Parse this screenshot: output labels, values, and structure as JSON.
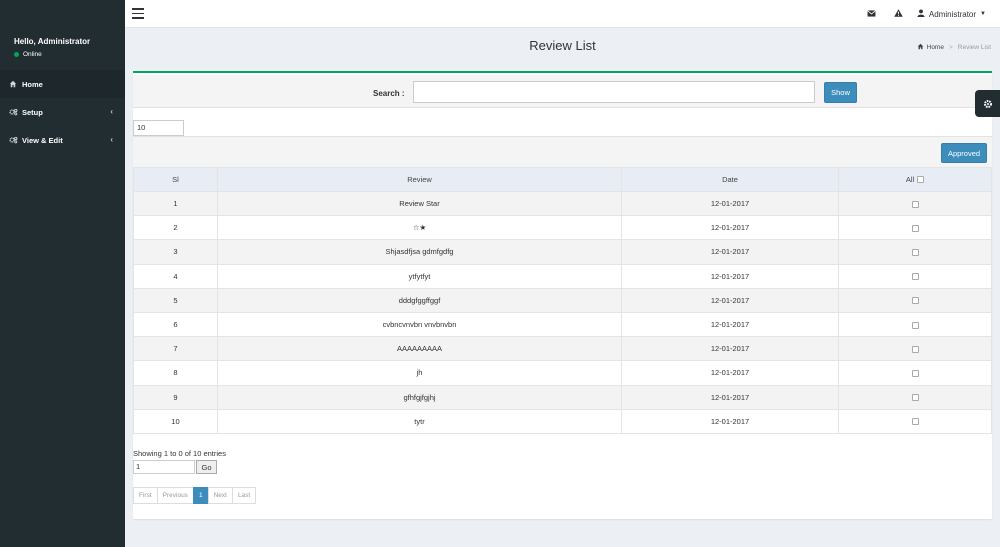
{
  "sidebar": {
    "greeting": "Hello, Administrator",
    "status": "Online",
    "items": [
      {
        "label": "Home",
        "icon": "home-icon"
      },
      {
        "label": "Setup",
        "icon": "cogs-icon"
      },
      {
        "label": "View & Edit",
        "icon": "cogs-icon"
      }
    ]
  },
  "navbar": {
    "user": "Administrator",
    "icons": [
      "envelope-icon",
      "warning-icon",
      "user-icon"
    ]
  },
  "header": {
    "title": "Review List",
    "breadcrumb": {
      "home": "Home",
      "current": "Review List"
    }
  },
  "search": {
    "label": "Search :",
    "value": "",
    "button": "Show"
  },
  "page_size": "10",
  "actions": {
    "approved": "Approved"
  },
  "table": {
    "columns": {
      "sl": "Sl",
      "review": "Review",
      "date": "Date",
      "all": "All"
    },
    "rows": [
      {
        "sl": "1",
        "review": "Review Star",
        "date": "12-01-2017"
      },
      {
        "sl": "2",
        "review": "☆★",
        "date": "12-01-2017"
      },
      {
        "sl": "3",
        "review": "Shjasdfjsa gdmfgdfg",
        "date": "12-01-2017"
      },
      {
        "sl": "4",
        "review": "ytfytfyt",
        "date": "12-01-2017"
      },
      {
        "sl": "5",
        "review": "dddgfggffggf",
        "date": "12-01-2017"
      },
      {
        "sl": "6",
        "review": "cvbncvnvbn vnvbnvbn",
        "date": "12-01-2017"
      },
      {
        "sl": "7",
        "review": "AAAAAAAAA",
        "date": "12-01-2017"
      },
      {
        "sl": "8",
        "review": "jh",
        "date": "12-01-2017"
      },
      {
        "sl": "9",
        "review": "gfhfgjfgjhj",
        "date": "12-01-2017"
      },
      {
        "sl": "10",
        "review": "tytr",
        "date": "12-01-2017"
      }
    ]
  },
  "footer": {
    "showing": "Showing 1 to 0 of 10 entries",
    "goto_value": "1",
    "go": "Go",
    "pager": {
      "first": "First",
      "previous": "Previous",
      "current": "1",
      "next": "Next",
      "last": "Last"
    }
  },
  "colors": {
    "sidebar": "#222d32",
    "primary": "#3c8dbc",
    "success": "#00a65a"
  }
}
